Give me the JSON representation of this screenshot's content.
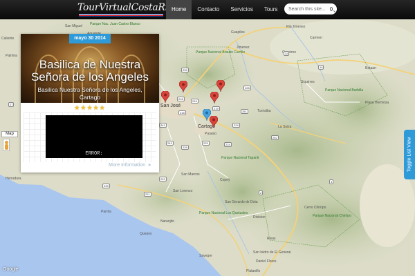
{
  "header": {
    "logo_text": "TourVirtualCostaRica",
    "nav": [
      "Home",
      "Contacto",
      "Servicios",
      "Tours"
    ],
    "search_placeholder": "Search this site..."
  },
  "map": {
    "places": [
      {
        "name": "Caliente",
        "type": "town"
      },
      {
        "name": "Palmira",
        "type": "town"
      },
      {
        "name": "Agualote",
        "type": "town"
      },
      {
        "name": "San Miguel",
        "type": "town"
      },
      {
        "name": "Parque Nac. Juan Castro Blanco",
        "type": "park"
      },
      {
        "name": "Guapiles",
        "type": "town"
      },
      {
        "name": "Rio Jimenez",
        "type": "town"
      },
      {
        "name": "Jimenez",
        "type": "town"
      },
      {
        "name": "Carmen",
        "type": "town"
      },
      {
        "name": "Parque Nacional Braulio Carrillo",
        "type": "park"
      },
      {
        "name": "Guacimo",
        "type": "town"
      },
      {
        "name": "Bataan",
        "type": "town"
      },
      {
        "name": "Siquirres",
        "type": "town"
      },
      {
        "name": "Parque Nacional Barbilla",
        "type": "park"
      },
      {
        "name": "Playa Hermosa",
        "type": "town"
      },
      {
        "name": "Turrialba",
        "type": "town"
      },
      {
        "name": "La Suiza",
        "type": "town"
      },
      {
        "name": "San José",
        "type": "city"
      },
      {
        "name": "Cartago",
        "type": "city"
      },
      {
        "name": "Paraiso",
        "type": "town"
      },
      {
        "name": "Parque Nacional Tapanti",
        "type": "park"
      },
      {
        "name": "Herradura",
        "type": "town"
      },
      {
        "name": "San Marcos",
        "type": "town"
      },
      {
        "name": "San Lorenzo",
        "type": "town"
      },
      {
        "name": "Copey",
        "type": "town"
      },
      {
        "name": "San Gerardo de Dota",
        "type": "town"
      },
      {
        "name": "Parrita",
        "type": "town"
      },
      {
        "name": "Parque Nacional Los Quetzales",
        "type": "park"
      },
      {
        "name": "Division",
        "type": "town"
      },
      {
        "name": "Parque Nacional Chirripo",
        "type": "park"
      },
      {
        "name": "Cerro Chirripo",
        "type": "town"
      },
      {
        "name": "Quepos",
        "type": "town"
      },
      {
        "name": "Naranjito",
        "type": "town"
      },
      {
        "name": "Rivas",
        "type": "town"
      },
      {
        "name": "Savegre",
        "type": "town"
      },
      {
        "name": "San Isidro de El General",
        "type": "town"
      },
      {
        "name": "Daniel Flores",
        "type": "town"
      },
      {
        "name": "Platanillo",
        "type": "town"
      }
    ],
    "route_shields": [
      "218",
      "219",
      "218",
      "219",
      "224",
      "224",
      "225",
      "226",
      "228",
      "232",
      "242",
      "243",
      "251",
      "252",
      "239",
      "221",
      "222",
      "27",
      "2",
      "32",
      "10",
      "4"
    ],
    "map_type_label": "Map",
    "google_logo": "Google"
  },
  "card": {
    "date_month": "mayo",
    "date_day": "30",
    "date_year": "2014",
    "title_line1": "Basilica de Nuestra",
    "title_line2": "Señora de los Angeles",
    "subtitle_line1": "Basilica Nuestra Señora de los Angeles,",
    "subtitle_line2": "Cartago",
    "rating": 5,
    "video_error": "ERROR:",
    "more_info": "More Information",
    "more_info_arrow": "»"
  },
  "toggle_list_view": "Toggle List View",
  "colors": {
    "accent_blue": "#2f9ad8",
    "marker_red": "#d9443b",
    "marker_blue": "#4aa3df",
    "header_bg": "#111111"
  }
}
